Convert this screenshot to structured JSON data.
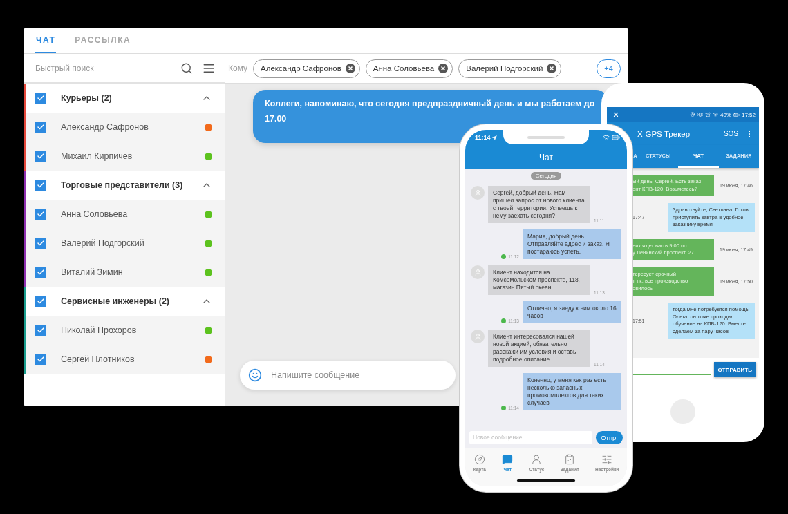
{
  "desktop": {
    "tabs": [
      {
        "label": "ЧАТ",
        "selected": true
      },
      {
        "label": "РАССЫЛКА",
        "selected": false
      }
    ],
    "search": {
      "placeholder": "Быстрый поиск"
    },
    "groups": [
      {
        "name": "Курьеры (2)",
        "color": "#e5483b",
        "checked": true,
        "expanded": true,
        "members": [
          {
            "name": "Александр Сафронов",
            "checked": true,
            "color": "#f26a1b"
          },
          {
            "name": "Михаил Кирпичев",
            "checked": true,
            "color": "#5cc21e"
          }
        ]
      },
      {
        "name": "Торговые представители (3)",
        "color": "#8e2fb0",
        "checked": true,
        "expanded": true,
        "members": [
          {
            "name": "Анна Соловьева",
            "checked": true,
            "color": "#5cc21e"
          },
          {
            "name": "Валерий Подгорский",
            "checked": true,
            "color": "#5cc21e"
          },
          {
            "name": "Виталий Зимин",
            "checked": true,
            "color": "#5cc21e"
          }
        ]
      },
      {
        "name": "Сервисные инженеры (2)",
        "color": "#1a9e8f",
        "checked": true,
        "expanded": true,
        "members": [
          {
            "name": "Николай Прохоров",
            "checked": true,
            "color": "#5cc21e"
          },
          {
            "name": "Сергей Плотников",
            "checked": true,
            "color": "#f26a1b"
          }
        ]
      }
    ],
    "recipients": {
      "label": "Кому",
      "chips": [
        "Александр Сафронов",
        "Анна Соловьева",
        "Валерий Подгорский"
      ],
      "more": "+4"
    },
    "messages": [
      {
        "text": "Коллеги, напоминаю, что сегодня предпраздничный день и мы работаем до 17.00"
      }
    ],
    "composer": {
      "placeholder": "Напишите сообщение"
    }
  },
  "iphone": {
    "time": "11:14",
    "title": "Чат",
    "date": "Сегодня",
    "messages": [
      {
        "kind": "incoming",
        "text": "Сергей, добрый день. Нам пришел запрос от нового клиента с твоей территории. Успеешь к нему заехать сегодня?",
        "time": "11:11"
      },
      {
        "kind": "outgoing",
        "text": "Мария, добрый день. Отправляйте адрес и заказ. Я постараюсь успеть.",
        "time": "11:12"
      },
      {
        "kind": "incoming",
        "text": "Клиент находится на Комсомольском проспекте, 118, магазин Пятый океан.",
        "time": "11:13"
      },
      {
        "kind": "outgoing",
        "text": "Отлично, я заеду к ним около 16 часов",
        "time": "11:13"
      },
      {
        "kind": "incoming",
        "text": "Клиент интересовался нашей новой акцией, обязательно расскажи им условия и оставь подробное описание",
        "time": "11:14"
      },
      {
        "kind": "outgoing",
        "text": "Конечно, у меня как раз есть несколько запасных промокомплектов для таких случаев",
        "time": "11:14"
      }
    ],
    "composer": {
      "placeholder": "Новое сообщение",
      "send": "Отпр."
    },
    "tabs": [
      {
        "label": "Карта",
        "kind": "map",
        "selected": false
      },
      {
        "label": "Чат",
        "kind": "chat",
        "selected": true
      },
      {
        "label": "Статус",
        "kind": "status",
        "selected": false
      },
      {
        "label": "Задания",
        "kind": "tasks",
        "selected": false
      },
      {
        "label": "Настройки",
        "kind": "settings",
        "selected": false
      }
    ]
  },
  "android": {
    "battery": "40%",
    "time": "17:52",
    "title": "X-GPS Трекер",
    "sos": "SOS",
    "tabs": [
      {
        "label": "А",
        "selected": false
      },
      {
        "label": "СТАТУСЫ",
        "selected": false
      },
      {
        "label": "ЧАТ",
        "selected": true
      },
      {
        "label": "ЗАДАНИЯ",
        "selected": false
      }
    ],
    "messages": [
      {
        "kind": "incoming",
        "text": "ый день, Сергей. Есть заказ\nонт КПВ-120. Возьметесь?",
        "time": "19 июня, 17:46"
      },
      {
        "kind": "outgoing",
        "text": "Здравствуйте, Светлана. Готов приступить завтра в удобное заказчику время",
        "time": "17:47"
      },
      {
        "kind": "incoming",
        "text": "ник ждет вас в 9.00 по\nу Ленинский проспект, 27",
        "time": "19 июня, 17:49"
      },
      {
        "kind": "incoming",
        "text": "тересует срочный\nт т.к. все производство\nовилось",
        "time": "19 июня, 17:50"
      },
      {
        "kind": "outgoing",
        "text": "тогда мне потребуется помощь Олега, он тоже проходил обучение на КПВ-120. Вместе сделаем за пару часов",
        "time": "17:51"
      }
    ],
    "send": "ОТПРАВИТЬ"
  }
}
